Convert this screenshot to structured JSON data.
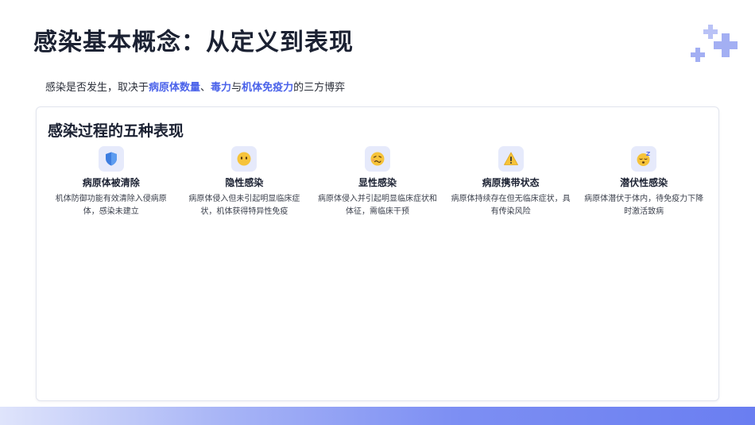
{
  "header": {
    "title": "感染基本概念：从定义到表现"
  },
  "subtitle": {
    "prefix": "感染是否发生，取决于",
    "term1": "病原体数量",
    "sep1": "、",
    "term2": "毒力",
    "sep2": "与",
    "term3": "机体免疫力",
    "suffix": "的三方博弈"
  },
  "panel": {
    "title": "感染过程的五种表现",
    "cards": [
      {
        "icon": "shield-icon",
        "title": "病原体被清除",
        "desc": "机体防御功能有效清除入侵病原体，感染未建立"
      },
      {
        "icon": "neutral-face-icon",
        "title": "隐性感染",
        "desc": "病原体侵入但未引起明显临床症状，机体获得特异性免疫"
      },
      {
        "icon": "sick-face-icon",
        "title": "显性感染",
        "desc": "病原体侵入并引起明显临床症状和体征，需临床干预"
      },
      {
        "icon": "warning-icon",
        "title": "病原携带状态",
        "desc": "病原体持续存在但无临床症状，具有传染风险"
      },
      {
        "icon": "sleeping-face-icon",
        "title": "潜伏性感染",
        "desc": "病原体潜伏于体内，待免疫力下降时激活致病"
      }
    ]
  },
  "colors": {
    "accent": "#4a62ea",
    "icon_bg": "#e6eafb",
    "plus_decoration": "#a7b2f4"
  }
}
